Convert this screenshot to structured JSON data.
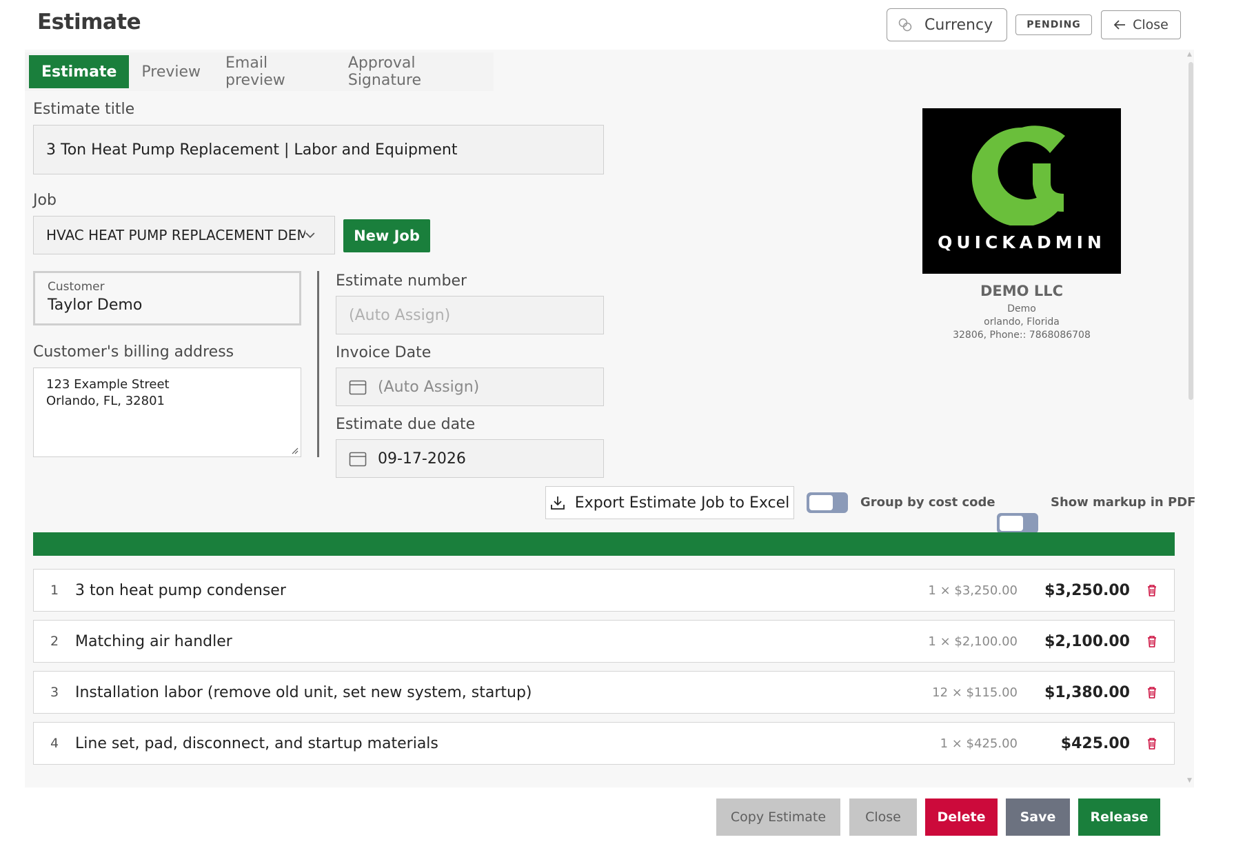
{
  "header": {
    "title": "Estimate",
    "currency_label": "Currency",
    "status_badge": "PENDING",
    "close_label": "Close"
  },
  "tabs": [
    {
      "label": "Estimate",
      "active": true
    },
    {
      "label": "Preview",
      "active": false
    },
    {
      "label": "Email preview",
      "active": false
    },
    {
      "label": "Approval Signature",
      "active": false
    }
  ],
  "form": {
    "estimate_title_label": "Estimate title",
    "estimate_title_value": "3 Ton Heat Pump Replacement | Labor and Equipment",
    "job_label": "Job",
    "job_value": "HVAC HEAT PUMP REPLACEMENT DEM",
    "new_job_label": "New Job",
    "customer_label": "Customer",
    "customer_value": "Taylor Demo",
    "billing_label": "Customer's billing address",
    "billing_line1": "123 Example Street",
    "billing_line2": "Orlando, FL, 32801",
    "estimate_number_label": "Estimate number",
    "estimate_number_placeholder": "(Auto Assign)",
    "invoice_date_label": "Invoice Date",
    "invoice_date_placeholder": "(Auto Assign)",
    "due_date_label": "Estimate due date",
    "due_date_value": "09-17-2026"
  },
  "company": {
    "logo_text": "QUICKADMIN",
    "name": "DEMO LLC",
    "line1": "Demo",
    "line2": "orlando, Florida",
    "line3": "32806, Phone:: 7868086708",
    "logo_color": "#6abf3b"
  },
  "toolbar": {
    "export_label": "Export Estimate Job to Excel",
    "group_by_label": "Group by cost code",
    "group_by_on": false,
    "show_markup_label": "Show markup in PDF",
    "show_markup_on": false
  },
  "line_items": [
    {
      "num": "1",
      "description": "3 ton heat pump condenser",
      "qty_price": "1 × $3,250.00",
      "total": "$3,250.00"
    },
    {
      "num": "2",
      "description": "Matching air handler",
      "qty_price": "1 × $2,100.00",
      "total": "$2,100.00"
    },
    {
      "num": "3",
      "description": "Installation labor (remove old unit, set new system, startup)",
      "qty_price": "12 × $115.00",
      "total": "$1,380.00"
    },
    {
      "num": "4",
      "description": "Line set, pad, disconnect, and startup materials",
      "qty_price": "1 × $425.00",
      "total": "$425.00"
    }
  ],
  "footer": {
    "copy_label": "Copy Estimate",
    "close_label": "Close",
    "delete_label": "Delete",
    "save_label": "Save",
    "release_label": "Release"
  },
  "colors": {
    "primary_green": "#1a7f3c",
    "danger": "#cc0a3b",
    "save_gray": "#6c7280"
  }
}
